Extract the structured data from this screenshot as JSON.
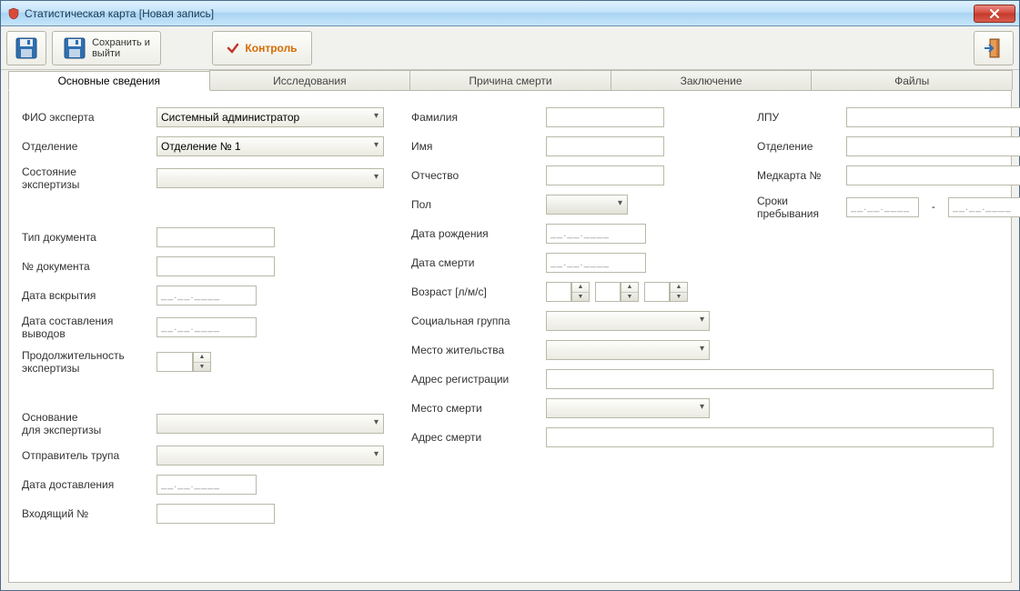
{
  "window": {
    "title": "Статистическая карта [Новая запись]"
  },
  "toolbar": {
    "save_exit": "Сохранить и\nвыйти",
    "control": "Контроль"
  },
  "tabs": [
    {
      "id": "main",
      "label": "Основные сведения",
      "active": true
    },
    {
      "id": "research",
      "label": "Исследования",
      "active": false
    },
    {
      "id": "cause",
      "label": "Причина смерти",
      "active": false
    },
    {
      "id": "conclusion",
      "label": "Заключение",
      "active": false
    },
    {
      "id": "files",
      "label": "Файлы",
      "active": false
    }
  ],
  "form": {
    "left": {
      "expert_label": "ФИО эксперта",
      "expert_value": "Системный администратор",
      "dept_label": "Отделение",
      "dept_value": "Отделение № 1",
      "status_label": "Состояние\nэкспертизы",
      "status_value": "",
      "doc_type_label": "Тип документа",
      "doc_type_value": "",
      "doc_no_label": "№ документа",
      "doc_no_value": "",
      "autopsy_date_label": "Дата вскрытия",
      "autopsy_date_value": "__.__.____",
      "conclusion_date_label": "Дата составления\nвыводов",
      "conclusion_date_value": "__.__.____",
      "duration_label": "Продолжительность\nэкспертизы",
      "duration_value": "",
      "basis_label": "Основание\nдля экспертизы",
      "basis_value": "",
      "sender_label": "Отправитель трупа",
      "sender_value": "",
      "delivery_date_label": "Дата доставления",
      "delivery_date_value": "__.__.____",
      "incoming_no_label": "Входящий №",
      "incoming_no_value": ""
    },
    "mid": {
      "lastname_label": "Фамилия",
      "lastname_value": "",
      "firstname_label": "Имя",
      "firstname_value": "",
      "patronymic_label": "Отчество",
      "patronymic_value": "",
      "sex_label": "Пол",
      "sex_value": "",
      "birth_label": "Дата рождения",
      "birth_value": "__.__.____",
      "death_label": "Дата смерти",
      "death_value": "__.__.____",
      "age_label": "Возраст [л/м/с]",
      "age_y": "",
      "age_m": "",
      "age_d": "",
      "social_label": "Социальная группа",
      "social_value": "",
      "residence_label": "Место жительства",
      "residence_value": "",
      "reg_addr_label": "Адрес регистрации",
      "reg_addr_value": "",
      "death_place_label": "Место смерти",
      "death_place_value": "",
      "death_addr_label": "Адрес смерти",
      "death_addr_value": ""
    },
    "right": {
      "lpu_label": "ЛПУ",
      "lpu_value": "",
      "dept_label": "Отделение",
      "dept_value": "",
      "medcard_label": "Медкарта №",
      "medcard_value": "",
      "stay_label": "Сроки\nпребывания",
      "stay_from": "__.__.____",
      "stay_to": "__.__.____",
      "stay_dash": "-"
    }
  }
}
